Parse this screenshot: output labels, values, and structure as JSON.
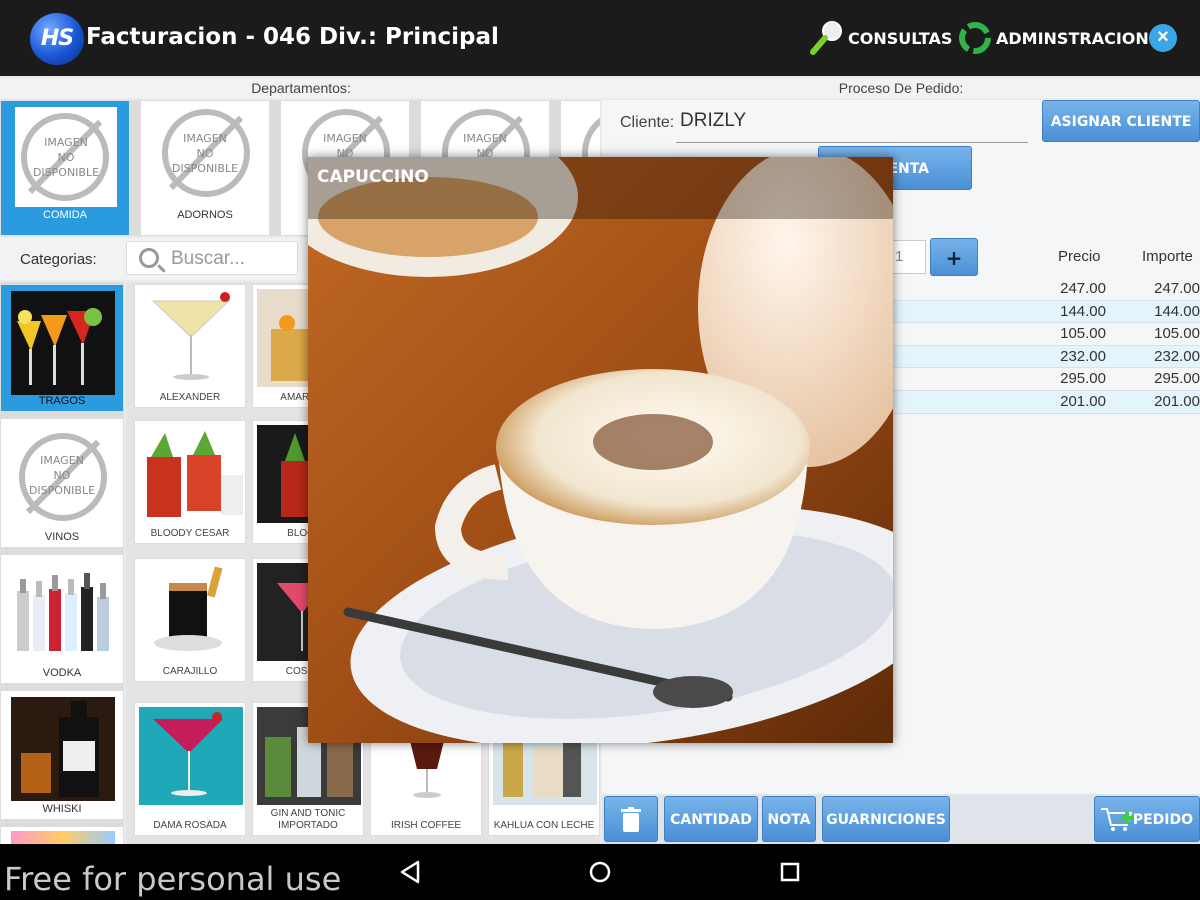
{
  "app": {
    "logo_text": "HS",
    "title": "Facturacion - 046 Div.: Principal",
    "consultas_label": "CONSULTAS",
    "admin_label": "ADMINSTRACION",
    "close_symbol": "×"
  },
  "headers": {
    "departamentos": "Departamentos:",
    "proceso": "Proceso De Pedido:"
  },
  "noimage": {
    "line1": "IMAGEN",
    "line2": "NO",
    "line3": "DISPONIBLE"
  },
  "departments": [
    {
      "label": "COMIDA",
      "selected": true
    },
    {
      "label": "ADORNOS",
      "selected": false
    },
    {
      "label": "",
      "selected": false
    },
    {
      "label": "",
      "selected": false
    },
    {
      "label": "",
      "selected": false
    }
  ],
  "categories_bar": {
    "label": "Categorias:",
    "search_placeholder": "Buscar..."
  },
  "categories": [
    {
      "label": "TRAGOS",
      "selected": true
    },
    {
      "label": "VINOS",
      "selected": false
    },
    {
      "label": "VODKA",
      "selected": false
    },
    {
      "label": "WHISKI",
      "selected": false
    }
  ],
  "products": [
    {
      "label": "ALEXANDER"
    },
    {
      "label": "AMARETTO"
    },
    {
      "label": "BLOODY CESAR"
    },
    {
      "label": "BLOODY"
    },
    {
      "label": "CARAJILLO"
    },
    {
      "label": "COSMOP"
    },
    {
      "label": "DAMA ROSADA"
    },
    {
      "label": "GIN AND TONIC IMPORTADO"
    },
    {
      "label": "IRISH COFFEE"
    },
    {
      "label": "KAHLUA CON LECHE"
    }
  ],
  "order": {
    "cliente_label": "Cliente:",
    "cliente_value": "DRIZLY",
    "asignar_label": "ASIGNAR CLIENTE",
    "cuenta_label": "-CUENTA",
    "quantity": "1",
    "plus_label": "+",
    "col_precio": "Precio",
    "col_importe": "Importe",
    "rows": [
      {
        "precio": "247.00",
        "importe": "247.00"
      },
      {
        "precio": "144.00",
        "importe": "144.00"
      },
      {
        "precio": "105.00",
        "importe": "105.00"
      },
      {
        "precio": "232.00",
        "importe": "232.00"
      },
      {
        "precio": "295.00",
        "importe": "295.00"
      },
      {
        "precio": "201.00",
        "importe": "201.00"
      }
    ]
  },
  "bottom_actions": {
    "cantidad": "CANTIDAD",
    "nota": "NOTA",
    "guarniciones": "GUARNICIONES",
    "pedido": "PEDIDO"
  },
  "overlay": {
    "title": "CAPUCCINO"
  },
  "watermark": "Free for personal use",
  "colors": {
    "accent_blue": "#2b9be0",
    "button_blue": "#4a8fd6",
    "topbar": "#1b1b1b",
    "row_alt": "#e3f4fa"
  }
}
